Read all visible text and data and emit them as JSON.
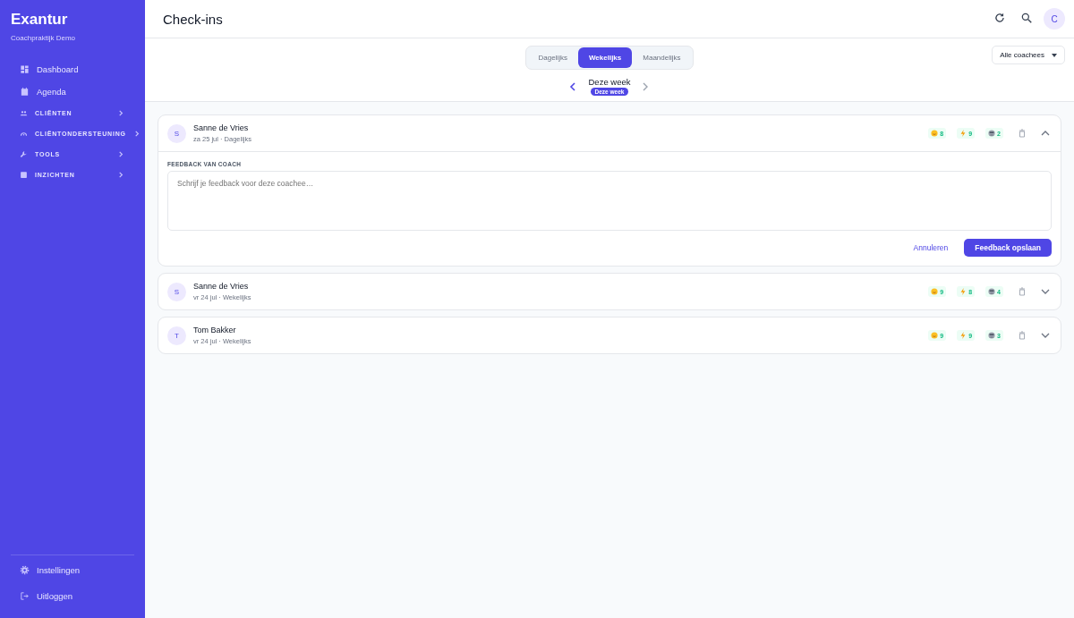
{
  "sidebar": {
    "brand": "Exantur",
    "subtitle": "Coachpraktijk Demo",
    "items": [
      {
        "kind": "link",
        "label": "Dashboard"
      },
      {
        "kind": "link",
        "label": "Agenda"
      },
      {
        "kind": "section",
        "label": "CLIËNTEN",
        "expanded": false
      },
      {
        "kind": "section",
        "label": "CLIËNTONDERSTEUNING",
        "expanded": false
      },
      {
        "kind": "section",
        "label": "TOOLS",
        "expanded": false
      },
      {
        "kind": "section",
        "label": "INZICHTEN",
        "expanded": false
      }
    ],
    "footer": [
      {
        "label": "Instellingen"
      },
      {
        "label": "Uitloggen"
      }
    ]
  },
  "header": {
    "title": "Check-ins",
    "avatar": "C"
  },
  "periods": [
    {
      "label": "Dagelijks",
      "selected": false
    },
    {
      "label": "Wekelijks",
      "selected": true
    },
    {
      "label": "Maandelijks",
      "selected": false
    }
  ],
  "week": {
    "label": "Deze week",
    "badge": "Deze week"
  },
  "filter": {
    "value": "Alle coachees"
  },
  "checkins": [
    {
      "initial": "S",
      "name": "Sanne de Vries",
      "meta": "za 25 jul · Dagelijks",
      "expanded": true,
      "scores": [
        {
          "kind": "mood",
          "value": "8"
        },
        {
          "kind": "energy",
          "value": "9"
        },
        {
          "kind": "stress",
          "value": "2"
        }
      ],
      "feedback": {
        "label": "FEEDBACK VAN COACH",
        "placeholder": "Schrijf je feedback voor deze coachee…",
        "cancel": "Annuleren",
        "save": "Feedback opslaan"
      }
    },
    {
      "initial": "S",
      "name": "Sanne de Vries",
      "meta": "vr 24 jul · Wekelijks",
      "expanded": false,
      "scores": [
        {
          "kind": "mood",
          "value": "9"
        },
        {
          "kind": "energy",
          "value": "8"
        },
        {
          "kind": "stress",
          "value": "4"
        }
      ]
    },
    {
      "initial": "T",
      "name": "Tom Bakker",
      "meta": "vr 24 jul · Wekelijks",
      "expanded": false,
      "scores": [
        {
          "kind": "mood",
          "value": "9"
        },
        {
          "kind": "energy",
          "value": "9"
        },
        {
          "kind": "stress",
          "value": "3"
        }
      ]
    }
  ]
}
